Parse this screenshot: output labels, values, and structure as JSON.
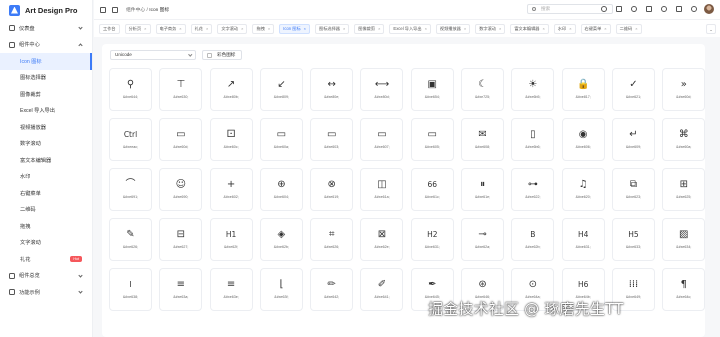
{
  "brand": {
    "name": "Art Design Pro"
  },
  "sidebar": {
    "items": [
      {
        "label": "仪表盘",
        "level": 0,
        "chevron": "down"
      },
      {
        "label": "组件中心",
        "level": 0,
        "chevron": "up"
      },
      {
        "label": "Icon 图标",
        "level": 1,
        "active": true
      },
      {
        "label": "图标选择器",
        "level": 1
      },
      {
        "label": "图像裁剪",
        "level": 1
      },
      {
        "label": "Excel 导入导出",
        "level": 1
      },
      {
        "label": "视频播放器",
        "level": 1
      },
      {
        "label": "数字滚动",
        "level": 1
      },
      {
        "label": "富文本编辑器",
        "level": 1
      },
      {
        "label": "水印",
        "level": 1
      },
      {
        "label": "右键菜单",
        "level": 1
      },
      {
        "label": "二维码",
        "level": 1
      },
      {
        "label": "拖拽",
        "level": 1
      },
      {
        "label": "文字滚动",
        "level": 1
      },
      {
        "label": "礼花",
        "level": 1,
        "badge": "Hot"
      },
      {
        "label": "组件总览",
        "level": 0,
        "chevron": "down"
      },
      {
        "label": "功能示例",
        "level": 0,
        "chevron": "down"
      }
    ]
  },
  "header": {
    "breadcrumb": {
      "parent": "组件中心",
      "separator": "/",
      "current": "Icon 图标"
    },
    "search_placeholder": "搜索",
    "tool_icons": [
      "refresh-icon",
      "fullscreen-icon",
      "language-icon",
      "notification-icon",
      "chat-icon",
      "theme-icon",
      "settings-icon"
    ]
  },
  "tabs": [
    {
      "label": "工作台",
      "closable": false
    },
    {
      "label": "分析页",
      "closable": true
    },
    {
      "label": "电子商务",
      "closable": true
    },
    {
      "label": "礼花",
      "closable": true
    },
    {
      "label": "文字滚动",
      "closable": true
    },
    {
      "label": "拖拽",
      "closable": true
    },
    {
      "label": "Icon 图标",
      "closable": true,
      "active": true
    },
    {
      "label": "图标选择器",
      "closable": true
    },
    {
      "label": "图像裁剪",
      "closable": true
    },
    {
      "label": "Excel 导入导出",
      "closable": true
    },
    {
      "label": "视频播放器",
      "closable": true
    },
    {
      "label": "数字滚动",
      "closable": true
    },
    {
      "label": "富文本编辑器",
      "closable": true
    },
    {
      "label": "水印",
      "closable": true
    },
    {
      "label": "右键菜单",
      "closable": true
    },
    {
      "label": "二维码",
      "closable": true
    }
  ],
  "controls": {
    "icon_type": "Unicode",
    "color_toggle_label": "彩色图标"
  },
  "icons": [
    {
      "glyph": "⚲",
      "code": "&#xe644;"
    },
    {
      "glyph": "⊤",
      "code": "&#xe630;"
    },
    {
      "glyph": "↗",
      "code": "&#xe80b;"
    },
    {
      "glyph": "↙",
      "code": "&#xe809;"
    },
    {
      "glyph": "↔",
      "code": "&#xe80e;"
    },
    {
      "glyph": "⟷",
      "code": "&#xe80d;"
    },
    {
      "glyph": "▣",
      "code": "&#xe654;"
    },
    {
      "glyph": "☾",
      "code": "&#xe725;"
    },
    {
      "glyph": "☀",
      "code": "&#xe6b5;"
    },
    {
      "glyph": "🔒",
      "code": "&#xe817;"
    },
    {
      "glyph": "✓",
      "code": "&#xe621;"
    },
    {
      "glyph": "»",
      "code": "&#xe60d;"
    },
    {
      "glyph": "Ctrl",
      "code": "&#xeeac;",
      "text": true
    },
    {
      "glyph": "▭",
      "code": "&#xe60d;"
    },
    {
      "glyph": "⚀",
      "code": "&#xe60c;"
    },
    {
      "glyph": "▭",
      "code": "&#xe60a;"
    },
    {
      "glyph": "▭",
      "code": "&#xe603;"
    },
    {
      "glyph": "▭",
      "code": "&#xe607;"
    },
    {
      "glyph": "▭",
      "code": "&#xe605;"
    },
    {
      "glyph": "✉",
      "code": "&#xe608;"
    },
    {
      "glyph": "▯",
      "code": "&#xe6b6;"
    },
    {
      "glyph": "◉",
      "code": "&#xe606;"
    },
    {
      "glyph": "↵",
      "code": "&#xe609;"
    },
    {
      "glyph": "⌘",
      "code": "&#xe60a;"
    },
    {
      "glyph": "⌒",
      "code": "&#xe691;"
    },
    {
      "glyph": "☺",
      "code": "&#xe690;"
    },
    {
      "glyph": "+",
      "code": "&#xe602;"
    },
    {
      "glyph": "⊕",
      "code": "&#xe604;"
    },
    {
      "glyph": "⊗",
      "code": "&#xe619;"
    },
    {
      "glyph": "◫",
      "code": "&#xe61a;"
    },
    {
      "glyph": "66",
      "code": "&#xe61c;",
      "text": true
    },
    {
      "glyph": "⏸",
      "code": "&#xe61e;"
    },
    {
      "glyph": "⊶",
      "code": "&#xe622;"
    },
    {
      "glyph": "♫",
      "code": "&#xe620;"
    },
    {
      "glyph": "⧉",
      "code": "&#xe623;"
    },
    {
      "glyph": "⊞",
      "code": "&#xe625;"
    },
    {
      "glyph": "✎",
      "code": "&#xe626;"
    },
    {
      "glyph": "⊟",
      "code": "&#xe627;"
    },
    {
      "glyph": "H1",
      "code": "&#xe62f;",
      "text": true
    },
    {
      "glyph": "◈",
      "code": "&#xe62b;"
    },
    {
      "glyph": "⌗",
      "code": "&#xe626;"
    },
    {
      "glyph": "⊠",
      "code": "&#xe62e;"
    },
    {
      "glyph": "H2",
      "code": "&#xe631;",
      "text": true
    },
    {
      "glyph": "⊸",
      "code": "&#xe62a;"
    },
    {
      "glyph": "B",
      "code": "&#xe62b;",
      "text": true
    },
    {
      "glyph": "H4",
      "code": "&#xe631;",
      "text": true
    },
    {
      "glyph": "H5",
      "code": "&#xe633;",
      "text": true
    },
    {
      "glyph": "▨",
      "code": "&#xe634;"
    },
    {
      "glyph": "I",
      "code": "&#xe638;",
      "text": true
    },
    {
      "glyph": "≡",
      "code": "&#xe63a;"
    },
    {
      "glyph": "≡",
      "code": "&#xe63e;"
    },
    {
      "glyph": "⌊",
      "code": "&#xe63f;"
    },
    {
      "glyph": "✏",
      "code": "&#xe642;"
    },
    {
      "glyph": "✐",
      "code": "&#xe641;"
    },
    {
      "glyph": "✒",
      "code": "&#xe645;"
    },
    {
      "glyph": "⊛",
      "code": "&#xe646;"
    },
    {
      "glyph": "⊙",
      "code": "&#xe64a;"
    },
    {
      "glyph": "H6",
      "code": "&#xe64b;",
      "text": true
    },
    {
      "glyph": "⁞⁞⁞",
      "code": "&#xe649;"
    },
    {
      "glyph": "¶",
      "code": "&#xe64c;"
    }
  ],
  "watermark": "掘金技术社区 @ 琢磨先生TT"
}
